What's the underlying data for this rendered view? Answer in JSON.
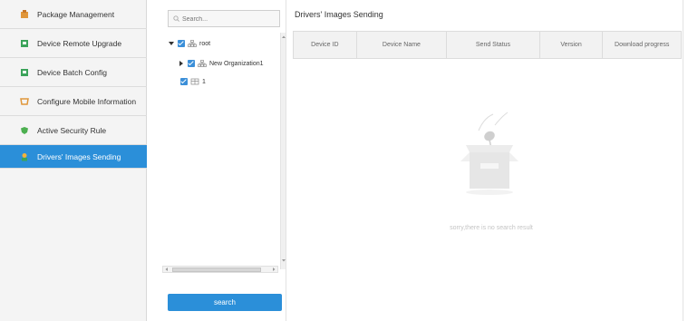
{
  "sidebar": {
    "items": [
      {
        "label": "Package Management",
        "icon": "package-icon",
        "color": "#e0963a"
      },
      {
        "label": "Device Remote Upgrade",
        "icon": "upgrade-icon",
        "color": "#3ba35a"
      },
      {
        "label": "Device Batch Config",
        "icon": "batch-config-icon",
        "color": "#3ba35a"
      },
      {
        "label": "Configure Mobile Information",
        "icon": "mobile-info-icon",
        "color": "#e0963a"
      },
      {
        "label": "Active Security Rule",
        "icon": "security-rule-icon",
        "color": "#4caf50"
      },
      {
        "label": "Drivers' Images Sending",
        "icon": "driver-image-icon",
        "color": "#e0963a"
      }
    ],
    "active_index": 5,
    "active_color": "#2b8fd9"
  },
  "tree": {
    "search_placeholder": "Search...",
    "nodes": [
      {
        "label": "root",
        "expanded": true
      },
      {
        "label": "New Organization1",
        "expanded": false
      },
      {
        "label": "1"
      }
    ],
    "search_button": "search"
  },
  "main": {
    "title": "Drivers' Images Sending",
    "columns": [
      "Device ID",
      "Device Name",
      "Send Status",
      "Version",
      "Download progress"
    ],
    "empty_message": "sorry,there is no search result"
  }
}
